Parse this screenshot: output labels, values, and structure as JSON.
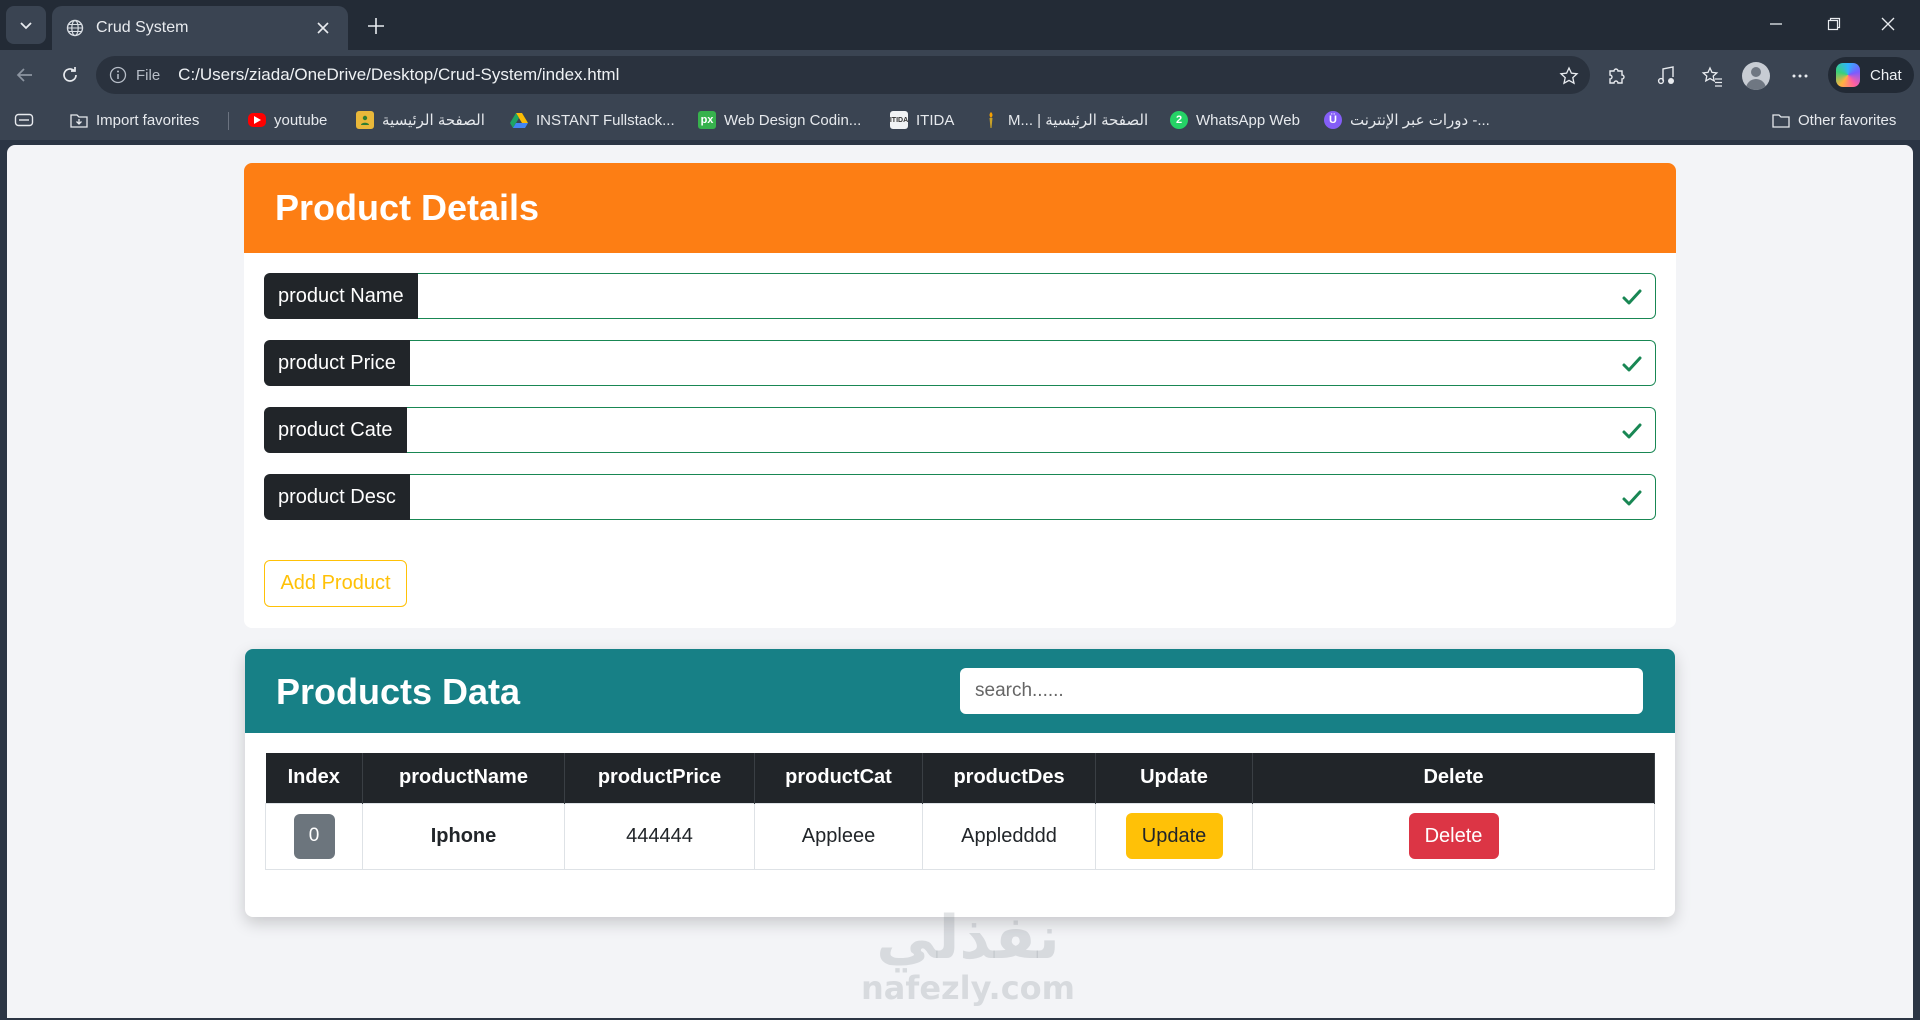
{
  "browser": {
    "tab_title": "Crud System",
    "url_scheme_label": "File",
    "url": "C:/Users/ziada/OneDrive/Desktop/Crud-System/index.html",
    "chat_label": "Chat",
    "bookmarks": {
      "import": "Import favorites",
      "youtube": "youtube",
      "home_ar": "الصفحة الرئيسية",
      "instant": "INSTANT Fullstack...",
      "webdesign": "Web Design Codin...",
      "itida": "ITIDA",
      "m_home": "M... | الصفحة الرئيسية",
      "whatsapp": "WhatsApp Web",
      "courses": "دورات عبر الإنترنت -...",
      "other": "Other favorites"
    }
  },
  "form": {
    "title": "Product Details",
    "fields": [
      {
        "label": "product Name",
        "value": ""
      },
      {
        "label": "product Price",
        "value": ""
      },
      {
        "label": "product Cate",
        "value": ""
      },
      {
        "label": "product Desc",
        "value": ""
      }
    ],
    "add_button": "Add Product"
  },
  "products": {
    "title": "Products Data",
    "search_placeholder": "search......",
    "columns": [
      "Index",
      "productName",
      "productPrice",
      "productCat",
      "productDes",
      "Update",
      "Delete"
    ],
    "rows": [
      {
        "index": "0",
        "name": "Iphone",
        "price": "444444",
        "category": "Appleee",
        "description": "Appledddd",
        "update_label": "Update",
        "delete_label": "Delete"
      }
    ]
  },
  "watermark": {
    "arabic": "نفذلي",
    "latin": "nafezly.com"
  },
  "colors": {
    "form_header": "#fd7e14",
    "table_header": "#178086",
    "valid": "#198754",
    "warning": "#ffc107",
    "danger": "#dc3545"
  }
}
